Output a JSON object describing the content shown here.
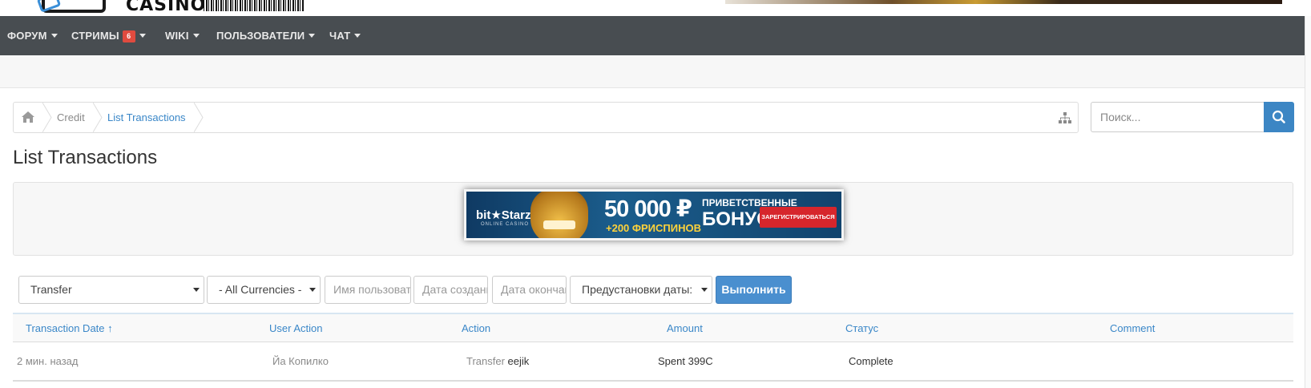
{
  "header": {
    "logo_text": "CASINO.MY"
  },
  "nav": {
    "items": [
      {
        "label": "ФОРУМ"
      },
      {
        "label": "СТРИМЫ",
        "badge": "6"
      },
      {
        "label": "WIKI"
      },
      {
        "label": "ПОЛЬЗОВАТЕЛИ"
      },
      {
        "label": "ЧАТ"
      }
    ]
  },
  "breadcrumb": {
    "items": [
      "Credit",
      "List Transactions"
    ]
  },
  "search": {
    "placeholder": "Поиск..."
  },
  "page_title": "List Transactions",
  "ad": {
    "brand": "bit★Starz",
    "brand_sub": "ONLINE CASINO",
    "amount": "50 000 ₽",
    "spins": "+200 ФРИСПИНОВ",
    "line1": "ПРИВЕТСТВЕННЫЕ",
    "line2": "БОНУСЫ",
    "cta": "ЗАРЕГИСТРИРОВАТЬСЯ"
  },
  "filters": {
    "type_value": "Transfer",
    "currency_value": "- All Currencies -",
    "username_placeholder": "Имя пользователя",
    "date_start_placeholder": "Дата создания",
    "date_end_placeholder": "Дата окончания",
    "date_presets_value": "Предустановки даты:",
    "submit_label": "Выполнить"
  },
  "table": {
    "columns": [
      "Transaction Date ↑",
      "User Action",
      "Action",
      "Amount",
      "Статус",
      "Comment"
    ],
    "rows": [
      {
        "date": "2 мин. назад",
        "user": "Йа Копилко",
        "action_type": "Transfer",
        "action_target": "eejik",
        "amount": "Spent 399C",
        "status": "Complete",
        "comment": ""
      }
    ]
  },
  "colors": {
    "nav_bg": "#484d51",
    "link": "#3a87c8",
    "primary_button": "#4a8fcf",
    "badge": "#e04b3f"
  }
}
